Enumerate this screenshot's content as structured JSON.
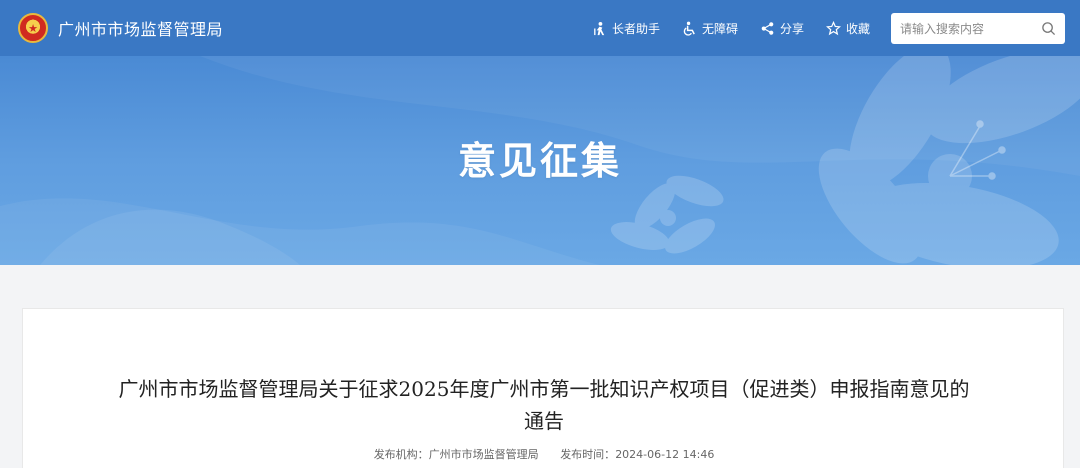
{
  "header": {
    "site_title": "广州市市场监督管理局",
    "emblem_icon": "national-emblem-icon",
    "tools": [
      {
        "label": "长者助手",
        "icon": "elder-assist-icon"
      },
      {
        "label": "无障碍",
        "icon": "accessibility-icon"
      },
      {
        "label": "分享",
        "icon": "share-icon"
      },
      {
        "label": "收藏",
        "icon": "star-icon"
      }
    ],
    "search": {
      "placeholder": "请输入搜索内容",
      "value": "",
      "icon": "search-icon"
    },
    "bg_color": "#3a78c4"
  },
  "banner": {
    "title": "意见征集",
    "color_top": "#4a8ad4",
    "color_bottom": "#6aa8e5"
  },
  "article": {
    "title": "广州市市场监督管理局关于征求2025年度广州市第一批知识产权项目（促进类）申报指南意见的通告",
    "meta": {
      "publisher_label": "发布机构：",
      "publisher": "广州市市场监督管理局",
      "time_label": "发布时间：",
      "time": "2024-06-12 14:46"
    }
  }
}
